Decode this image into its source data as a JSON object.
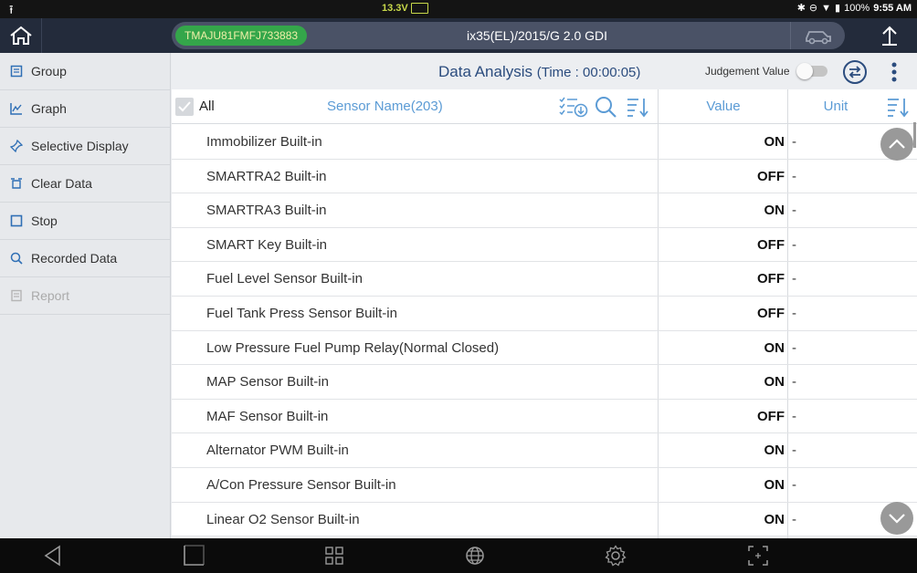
{
  "status_bar": {
    "voltage": "13.3V",
    "battery_percent": "100%",
    "clock": "9:55 AM"
  },
  "title_bar": {
    "vin": "TMAJU81FMFJ733883",
    "vehicle": "ix35(EL)/2015/G 2.0 GDI"
  },
  "sidebar": {
    "items": [
      {
        "label": "Group",
        "icon": "group-icon",
        "enabled": true
      },
      {
        "label": "Graph",
        "icon": "graph-icon",
        "enabled": true
      },
      {
        "label": "Selective Display",
        "icon": "pin-icon",
        "enabled": true
      },
      {
        "label": "Clear Data",
        "icon": "clear-icon",
        "enabled": true
      },
      {
        "label": "Stop",
        "icon": "stop-icon",
        "enabled": true
      },
      {
        "label": "Recorded Data",
        "icon": "recorded-icon",
        "enabled": true
      },
      {
        "label": "Report",
        "icon": "report-icon",
        "enabled": false
      }
    ]
  },
  "main": {
    "title": "Data Analysis",
    "time_label": "(Time : 00:00:05)",
    "judgement_label": "Judgement Value",
    "judgement_on": false
  },
  "table": {
    "all_label": "All",
    "sensor_header": "Sensor Name(203)",
    "value_header": "Value",
    "unit_header": "Unit",
    "rows": [
      {
        "name": "Immobilizer Built-in",
        "value": "ON",
        "unit": "-"
      },
      {
        "name": "SMARTRA2 Built-in",
        "value": "OFF",
        "unit": "-"
      },
      {
        "name": "SMARTRA3 Built-in",
        "value": "ON",
        "unit": "-"
      },
      {
        "name": "SMART Key Built-in",
        "value": "OFF",
        "unit": "-"
      },
      {
        "name": "Fuel Level Sensor Built-in",
        "value": "OFF",
        "unit": "-"
      },
      {
        "name": "Fuel Tank Press Sensor Built-in",
        "value": "OFF",
        "unit": "-"
      },
      {
        "name": "Low Pressure Fuel Pump Relay(Normal Closed)",
        "value": "ON",
        "unit": "-"
      },
      {
        "name": "MAP Sensor Built-in",
        "value": "ON",
        "unit": "-"
      },
      {
        "name": "MAF Sensor Built-in",
        "value": "OFF",
        "unit": "-"
      },
      {
        "name": "Alternator PWM Built-in",
        "value": "ON",
        "unit": "-"
      },
      {
        "name": "A/Con Pressure Sensor Built-in",
        "value": "ON",
        "unit": "-"
      },
      {
        "name": "Linear O2 Sensor Built-in",
        "value": "ON",
        "unit": "-"
      }
    ]
  },
  "colors": {
    "title_bar": "#232b3b",
    "vin_pill": "#34a64a",
    "accent_blue": "#5b9bd5",
    "title_blue": "#2b4c7e",
    "icon_blue": "#2f6fb5"
  }
}
